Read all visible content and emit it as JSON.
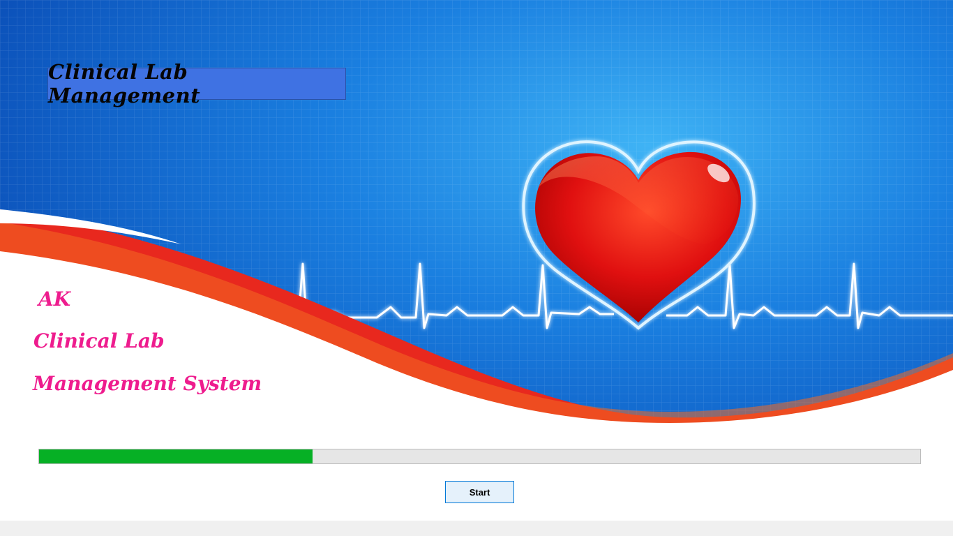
{
  "splash": {
    "title": "Clinical Lab Management",
    "brand_ak": "AK",
    "brand_line1": "Clinical Lab",
    "brand_line2": "Management System"
  },
  "progress": {
    "value_fraction": 0.31
  },
  "start_button": {
    "label": "Start"
  },
  "colors": {
    "background_blue": "#1a73d8",
    "heart_red": "#e01010",
    "wave_red": "#e8281e",
    "brand_pink": "#ee1c8e",
    "title_box": "#3f72e3",
    "progress_green": "#06b025",
    "progress_track": "#e6e6e6",
    "button_border": "#0078d7"
  },
  "icons": {
    "heart": "heart-icon",
    "ecg": "heartbeat-line"
  }
}
